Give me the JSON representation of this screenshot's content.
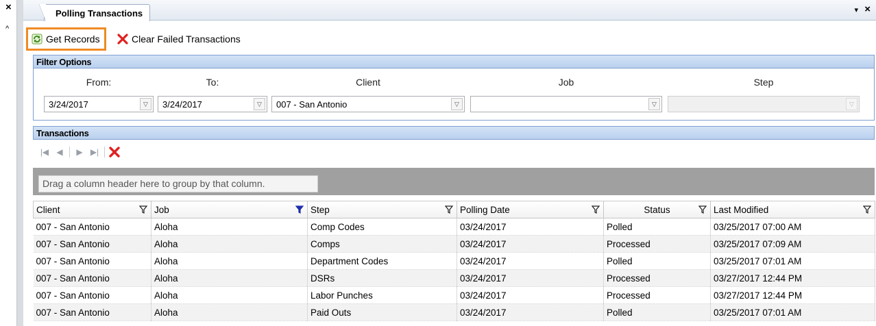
{
  "rail": {
    "close_glyph": "×",
    "up_glyph": "^"
  },
  "tab": {
    "title": "Polling Transactions",
    "dropdown_glyph": "▾",
    "close_glyph": "×"
  },
  "toolbar": {
    "get_records_label": "Get Records",
    "clear_failed_label": "Clear Failed Transactions",
    "get_records_icon": "refresh-icon",
    "clear_failed_icon": "red-x-icon",
    "highlight_color": "#f08a24"
  },
  "filter": {
    "header": "Filter Options",
    "labels": {
      "from": "From:",
      "to": "To:",
      "client": "Client",
      "job": "Job",
      "step": "Step"
    },
    "values": {
      "from": "3/24/2017",
      "to": "3/24/2017",
      "client": "007 - San Antonio",
      "job": "",
      "step": ""
    }
  },
  "transactions": {
    "header": "Transactions",
    "group_hint": "Drag a column header here to group by that column.",
    "columns": [
      "Client",
      "Job",
      "Step",
      "Polling Date",
      "Status",
      "Last Modified"
    ],
    "rows": [
      [
        "007 - San Antonio",
        "Aloha",
        "Comp Codes",
        "03/24/2017",
        "Polled",
        "03/25/2017 07:00 AM"
      ],
      [
        "007 - San Antonio",
        "Aloha",
        "Comps",
        "03/24/2017",
        "Processed",
        "03/25/2017 07:09 AM"
      ],
      [
        "007 - San Antonio",
        "Aloha",
        "Department Codes",
        "03/24/2017",
        "Polled",
        "03/25/2017 07:01 AM"
      ],
      [
        "007 - San Antonio",
        "Aloha",
        "DSRs",
        "03/24/2017",
        "Processed",
        "03/27/2017 12:44 PM"
      ],
      [
        "007 - San Antonio",
        "Aloha",
        "Labor Punches",
        "03/24/2017",
        "Processed",
        "03/27/2017 12:44 PM"
      ],
      [
        "007 - San Antonio",
        "Aloha",
        "Paid Outs",
        "03/24/2017",
        "Polled",
        "03/25/2017 07:01 AM"
      ]
    ],
    "active_filter_column": "Job"
  },
  "colors": {
    "panel_header": "#b9d0ee",
    "active_filter": "#1f2fa8",
    "delete_red": "#e02020"
  }
}
